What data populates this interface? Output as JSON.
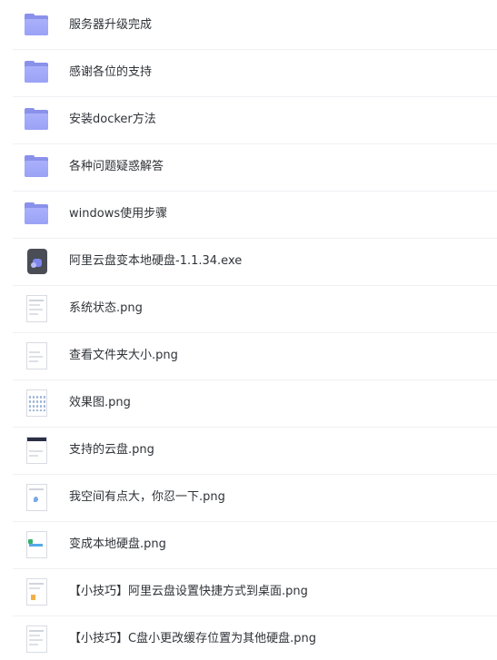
{
  "files": [
    {
      "name": "服务器升级完成",
      "icon": "folder-icon"
    },
    {
      "name": "感谢各位的支持",
      "icon": "folder-icon"
    },
    {
      "name": "安装docker方法",
      "icon": "folder-icon"
    },
    {
      "name": "各种问题疑惑解答",
      "icon": "folder-icon"
    },
    {
      "name": "windows使用步骤",
      "icon": "folder-icon"
    },
    {
      "name": "阿里云盘变本地硬盘-1.1.34.exe",
      "icon": "exe-file-icon"
    },
    {
      "name": "系统状态.png",
      "icon": "image-thumbnail-icon"
    },
    {
      "name": "查看文件夹大小.png",
      "icon": "image-thumbnail-icon"
    },
    {
      "name": "效果图.png",
      "icon": "image-thumbnail-icon"
    },
    {
      "name": "支持的云盘.png",
      "icon": "image-thumbnail-icon"
    },
    {
      "name": "我空间有点大，你忍一下.png",
      "icon": "image-thumbnail-icon"
    },
    {
      "name": "变成本地硬盘.png",
      "icon": "image-thumbnail-icon"
    },
    {
      "name": "【小技巧】阿里云盘设置快捷方式到桌面.png",
      "icon": "image-thumbnail-icon"
    },
    {
      "name": "【小技巧】C盘小更改缓存位置为其他硬盘.png",
      "icon": "image-thumbnail-icon"
    }
  ],
  "colors": {
    "folder": "#9aa2f6",
    "exe": "#4a4d55",
    "text": "#2f3338",
    "divider": "#f0f1f4"
  }
}
